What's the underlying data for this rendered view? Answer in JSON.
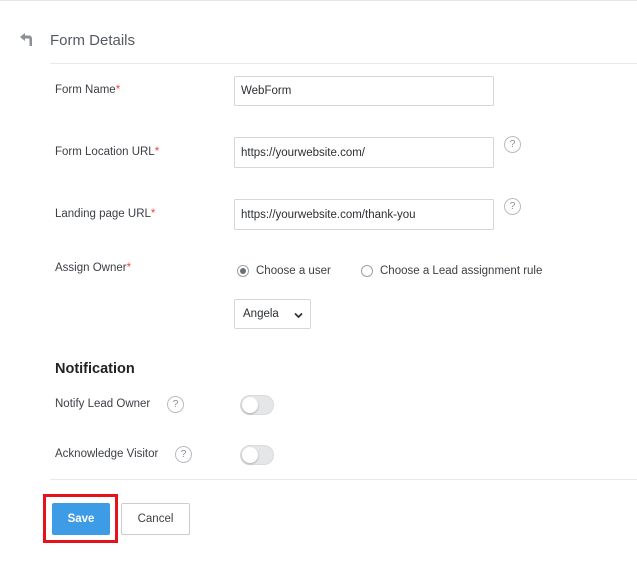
{
  "header": {
    "title": "Form Details",
    "back_icon": "back-arrow-icon"
  },
  "form": {
    "form_name": {
      "label": "Form Name",
      "required_mark": "*",
      "value": "WebForm"
    },
    "form_location_url": {
      "label": "Form Location URL",
      "required_mark": "*",
      "value": "https://yourwebsite.com/",
      "help": "?"
    },
    "landing_page_url": {
      "label": "Landing page URL",
      "required_mark": "*",
      "value": "https://yourwebsite.com/thank-you",
      "help": "?"
    },
    "assign_owner": {
      "label": "Assign Owner",
      "required_mark": "*",
      "options": [
        {
          "label": "Choose a user",
          "selected": true
        },
        {
          "label": "Choose a Lead assignment rule",
          "selected": false
        }
      ],
      "selected_user": "Angela"
    }
  },
  "notification": {
    "title": "Notification",
    "notify_lead_owner": {
      "label": "Notify Lead Owner",
      "help": "?",
      "enabled": false
    },
    "acknowledge_visitor": {
      "label": "Acknowledge Visitor",
      "help": "?",
      "enabled": false
    }
  },
  "footer": {
    "save_label": "Save",
    "cancel_label": "Cancel"
  },
  "colors": {
    "primary": "#3e9ce6",
    "highlight": "#e3121b",
    "required": "#e5484d"
  }
}
